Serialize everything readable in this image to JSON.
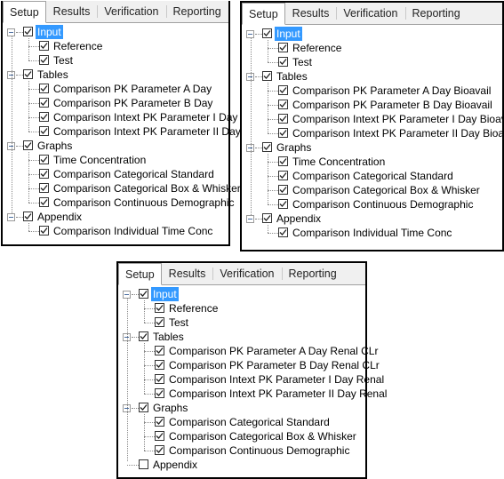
{
  "tabs": [
    "Setup",
    "Results",
    "Verification",
    "Reporting"
  ],
  "active_tab": "Setup",
  "colors": {
    "selection": "#3399ff",
    "tab_bar": "#f0f0f0"
  },
  "panels": [
    {
      "id": "p1",
      "nodes": [
        {
          "label": "Input",
          "checked": true,
          "selected": true,
          "children": [
            {
              "label": "Reference",
              "checked": true
            },
            {
              "label": "Test",
              "checked": true
            }
          ]
        },
        {
          "label": "Tables",
          "checked": true,
          "children": [
            {
              "label": "Comparison PK Parameter A Day",
              "checked": true
            },
            {
              "label": "Comparison PK Parameter B Day",
              "checked": true
            },
            {
              "label": "Comparison Intext PK Parameter I Day",
              "checked": true
            },
            {
              "label": "Comparison Intext PK Parameter II Day",
              "checked": true
            }
          ]
        },
        {
          "label": "Graphs",
          "checked": true,
          "children": [
            {
              "label": "Time Concentration",
              "checked": true
            },
            {
              "label": "Comparison Categorical Standard",
              "checked": true
            },
            {
              "label": "Comparison Categorical Box & Whisker",
              "checked": true
            },
            {
              "label": "Comparison Continuous Demographic",
              "checked": true
            }
          ]
        },
        {
          "label": "Appendix",
          "checked": true,
          "children": [
            {
              "label": "Comparison Individual Time Conc",
              "checked": true
            }
          ]
        }
      ]
    },
    {
      "id": "p2",
      "nodes": [
        {
          "label": "Input",
          "checked": true,
          "selected": true,
          "children": [
            {
              "label": "Reference",
              "checked": true
            },
            {
              "label": "Test",
              "checked": true
            }
          ]
        },
        {
          "label": "Tables",
          "checked": true,
          "children": [
            {
              "label": "Comparison PK Parameter A Day Bioavail",
              "checked": true
            },
            {
              "label": "Comparison PK Parameter B Day Bioavail",
              "checked": true
            },
            {
              "label": "Comparison Intext PK Parameter I Day Bioavail",
              "checked": true
            },
            {
              "label": "Comparison Intext PK Parameter II Day Bioavail",
              "checked": true
            }
          ]
        },
        {
          "label": "Graphs",
          "checked": true,
          "children": [
            {
              "label": "Time Concentration",
              "checked": true
            },
            {
              "label": "Comparison Categorical Standard",
              "checked": true
            },
            {
              "label": "Comparison Categorical Box & Whisker",
              "checked": true
            },
            {
              "label": "Comparison Continuous Demographic",
              "checked": true
            }
          ]
        },
        {
          "label": "Appendix",
          "checked": true,
          "children": [
            {
              "label": "Comparison Individual Time Conc",
              "checked": true
            }
          ]
        }
      ]
    },
    {
      "id": "p3",
      "nodes": [
        {
          "label": "Input",
          "checked": true,
          "selected": true,
          "children": [
            {
              "label": "Reference",
              "checked": true
            },
            {
              "label": "Test",
              "checked": true
            }
          ]
        },
        {
          "label": "Tables",
          "checked": true,
          "children": [
            {
              "label": "Comparison PK Parameter A Day Renal CLr",
              "checked": true
            },
            {
              "label": "Comparison PK Parameter B Day Renal CLr",
              "checked": true
            },
            {
              "label": "Comparison Intext PK Parameter I Day Renal",
              "checked": true
            },
            {
              "label": "Comparison Intext PK Parameter II Day Renal",
              "checked": true
            }
          ]
        },
        {
          "label": "Graphs",
          "checked": true,
          "children": [
            {
              "label": "Comparison Categorical Standard",
              "checked": true
            },
            {
              "label": "Comparison Categorical Box & Whisker",
              "checked": true
            },
            {
              "label": "Comparison Continuous Demographic",
              "checked": true
            }
          ]
        },
        {
          "label": "Appendix",
          "checked": false,
          "children": []
        }
      ]
    }
  ]
}
